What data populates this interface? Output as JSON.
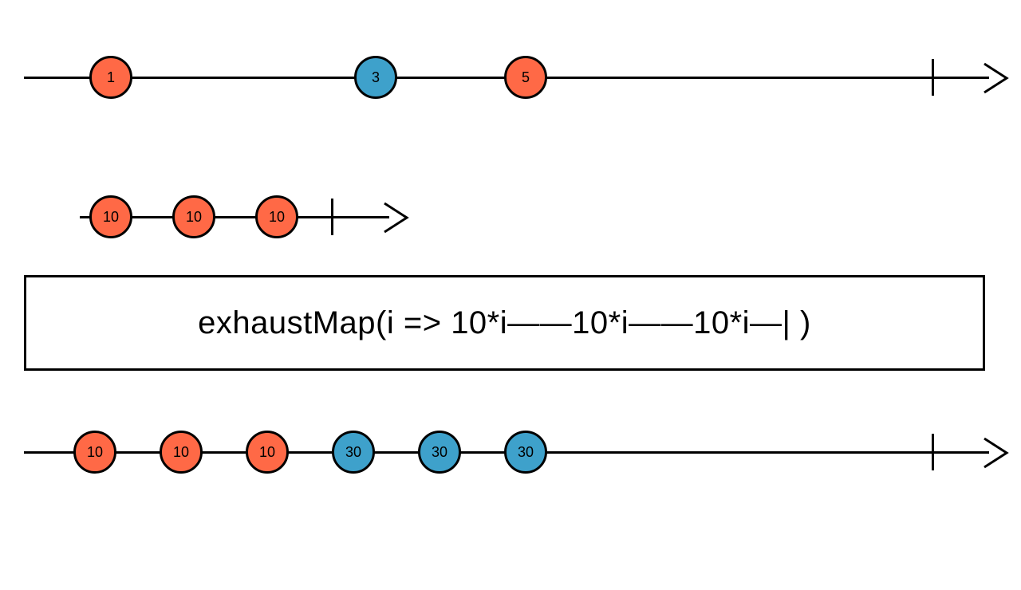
{
  "chart_data": {
    "type": "marble-diagram",
    "operator_label": "exhaustMap(i => 10*i——10*i——10*i—| )",
    "colors": {
      "orange": "#ff6946",
      "blue": "#3ea1cb"
    },
    "input_stream": {
      "events": [
        {
          "t": 1,
          "value": "1",
          "color": "orange"
        },
        {
          "t": 4,
          "value": "3",
          "color": "blue"
        },
        {
          "t": 6,
          "value": "5",
          "color": "orange"
        }
      ],
      "complete_t": 11
    },
    "inner_stream_template": {
      "events": [
        {
          "t": 0,
          "value": "10",
          "color": "orange"
        },
        {
          "t": 1,
          "value": "10",
          "color": "orange"
        },
        {
          "t": 2,
          "value": "10",
          "color": "orange"
        }
      ],
      "complete_t": 2.5
    },
    "output_stream": {
      "events": [
        {
          "t": 1,
          "value": "10",
          "color": "orange"
        },
        {
          "t": 2,
          "value": "10",
          "color": "orange"
        },
        {
          "t": 3,
          "value": "10",
          "color": "orange"
        },
        {
          "t": 4,
          "value": "30",
          "color": "blue"
        },
        {
          "t": 5,
          "value": "30",
          "color": "blue"
        },
        {
          "t": 6,
          "value": "30",
          "color": "blue"
        }
      ],
      "complete_t": 11
    }
  }
}
